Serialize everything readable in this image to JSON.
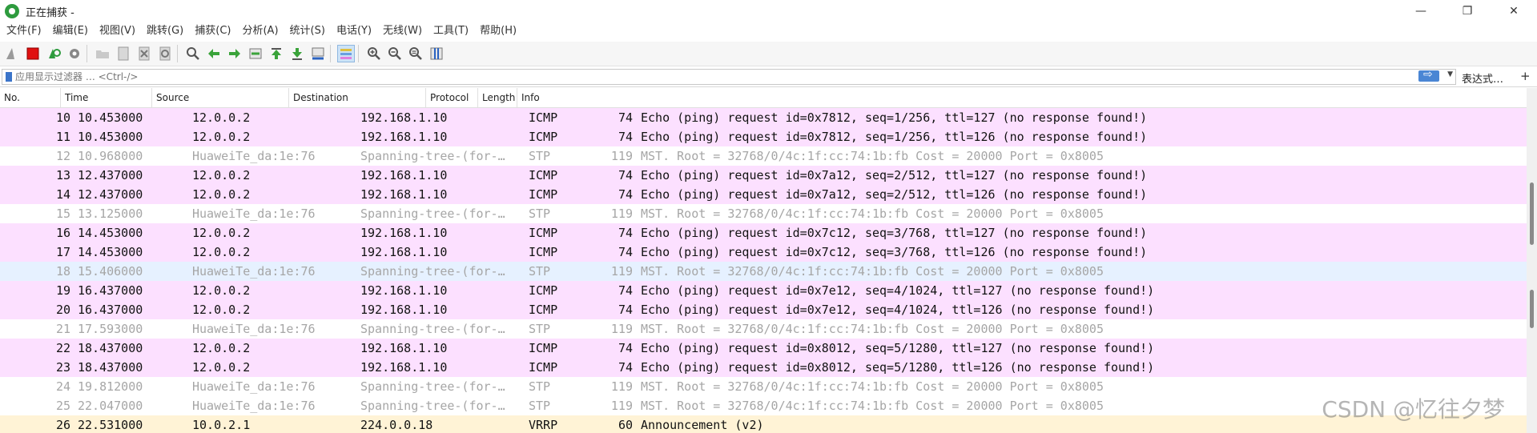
{
  "window": {
    "title": "正在捕获 -",
    "controls": {
      "minimize": "—",
      "restore": "❐",
      "close": "✕"
    }
  },
  "menu": [
    "文件(F)",
    "编辑(E)",
    "视图(V)",
    "跳转(G)",
    "捕获(C)",
    "分析(A)",
    "统计(S)",
    "电话(Y)",
    "无线(W)",
    "工具(T)",
    "帮助(H)"
  ],
  "filter": {
    "placeholder": "应用显示过滤器 … <Ctrl-/>",
    "expression_label": "表达式…",
    "plus": "+"
  },
  "packet_list": {
    "columns": [
      "No.",
      "Time",
      "Source",
      "Destination",
      "Protocol",
      "Length",
      "Info"
    ],
    "rows": [
      {
        "no": "10",
        "time": "10.453000",
        "src": "12.0.0.2",
        "dst": "192.168.1.10",
        "proto": "ICMP",
        "len": "74",
        "info": "Echo (ping) request  id=0x7812, seq=1/256, ttl=127 (no response found!)",
        "kind": "icmp"
      },
      {
        "no": "11",
        "time": "10.453000",
        "src": "12.0.0.2",
        "dst": "192.168.1.10",
        "proto": "ICMP",
        "len": "74",
        "info": "Echo (ping) request  id=0x7812, seq=1/256, ttl=126 (no response found!)",
        "kind": "icmp"
      },
      {
        "no": "12",
        "time": "10.968000",
        "src": "HuaweiTe_da:1e:76",
        "dst": "Spanning-tree-(for-…",
        "proto": "STP",
        "len": "119",
        "info": "MST. Root = 32768/0/4c:1f:cc:74:1b:fb  Cost = 20000  Port = 0x8005",
        "kind": "stp"
      },
      {
        "no": "13",
        "time": "12.437000",
        "src": "12.0.0.2",
        "dst": "192.168.1.10",
        "proto": "ICMP",
        "len": "74",
        "info": "Echo (ping) request  id=0x7a12, seq=2/512, ttl=127 (no response found!)",
        "kind": "icmp"
      },
      {
        "no": "14",
        "time": "12.437000",
        "src": "12.0.0.2",
        "dst": "192.168.1.10",
        "proto": "ICMP",
        "len": "74",
        "info": "Echo (ping) request  id=0x7a12, seq=2/512, ttl=126 (no response found!)",
        "kind": "icmp"
      },
      {
        "no": "15",
        "time": "13.125000",
        "src": "HuaweiTe_da:1e:76",
        "dst": "Spanning-tree-(for-…",
        "proto": "STP",
        "len": "119",
        "info": "MST. Root = 32768/0/4c:1f:cc:74:1b:fb  Cost = 20000  Port = 0x8005",
        "kind": "stp"
      },
      {
        "no": "16",
        "time": "14.453000",
        "src": "12.0.0.2",
        "dst": "192.168.1.10",
        "proto": "ICMP",
        "len": "74",
        "info": "Echo (ping) request  id=0x7c12, seq=3/768, ttl=127 (no response found!)",
        "kind": "icmp"
      },
      {
        "no": "17",
        "time": "14.453000",
        "src": "12.0.0.2",
        "dst": "192.168.1.10",
        "proto": "ICMP",
        "len": "74",
        "info": "Echo (ping) request  id=0x7c12, seq=3/768, ttl=126 (no response found!)",
        "kind": "icmp"
      },
      {
        "no": "18",
        "time": "15.406000",
        "src": "HuaweiTe_da:1e:76",
        "dst": "Spanning-tree-(for-…",
        "proto": "STP",
        "len": "119",
        "info": "MST. Root = 32768/0/4c:1f:cc:74:1b:fb  Cost = 20000  Port = 0x8005",
        "kind": "stp selected"
      },
      {
        "no": "19",
        "time": "16.437000",
        "src": "12.0.0.2",
        "dst": "192.168.1.10",
        "proto": "ICMP",
        "len": "74",
        "info": "Echo (ping) request  id=0x7e12, seq=4/1024, ttl=127 (no response found!)",
        "kind": "icmp"
      },
      {
        "no": "20",
        "time": "16.437000",
        "src": "12.0.0.2",
        "dst": "192.168.1.10",
        "proto": "ICMP",
        "len": "74",
        "info": "Echo (ping) request  id=0x7e12, seq=4/1024, ttl=126 (no response found!)",
        "kind": "icmp"
      },
      {
        "no": "21",
        "time": "17.593000",
        "src": "HuaweiTe_da:1e:76",
        "dst": "Spanning-tree-(for-…",
        "proto": "STP",
        "len": "119",
        "info": "MST. Root = 32768/0/4c:1f:cc:74:1b:fb  Cost = 20000  Port = 0x8005",
        "kind": "stp"
      },
      {
        "no": "22",
        "time": "18.437000",
        "src": "12.0.0.2",
        "dst": "192.168.1.10",
        "proto": "ICMP",
        "len": "74",
        "info": "Echo (ping) request  id=0x8012, seq=5/1280, ttl=127 (no response found!)",
        "kind": "icmp"
      },
      {
        "no": "23",
        "time": "18.437000",
        "src": "12.0.0.2",
        "dst": "192.168.1.10",
        "proto": "ICMP",
        "len": "74",
        "info": "Echo (ping) request  id=0x8012, seq=5/1280, ttl=126 (no response found!)",
        "kind": "icmp"
      },
      {
        "no": "24",
        "time": "19.812000",
        "src": "HuaweiTe_da:1e:76",
        "dst": "Spanning-tree-(for-…",
        "proto": "STP",
        "len": "119",
        "info": "MST. Root = 32768/0/4c:1f:cc:74:1b:fb  Cost = 20000  Port = 0x8005",
        "kind": "stp"
      },
      {
        "no": "25",
        "time": "22.047000",
        "src": "HuaweiTe_da:1e:76",
        "dst": "Spanning-tree-(for-…",
        "proto": "STP",
        "len": "119",
        "info": "MST. Root = 32768/0/4c:1f:cc:74:1b:fb  Cost = 20000  Port = 0x8005",
        "kind": "stp"
      },
      {
        "no": "26",
        "time": "22.531000",
        "src": "10.0.2.1",
        "dst": "224.0.0.18",
        "proto": "VRRP",
        "len": "60",
        "info": "Announcement (v2)",
        "kind": "vrrp"
      }
    ]
  },
  "watermark": "CSDN @忆往夕梦",
  "colors": {
    "icmp_row": "#fce0ff",
    "stp_row": "#ffffff",
    "selected_row": "#e6f1ff",
    "vrrp_row": "#fff3d6"
  }
}
